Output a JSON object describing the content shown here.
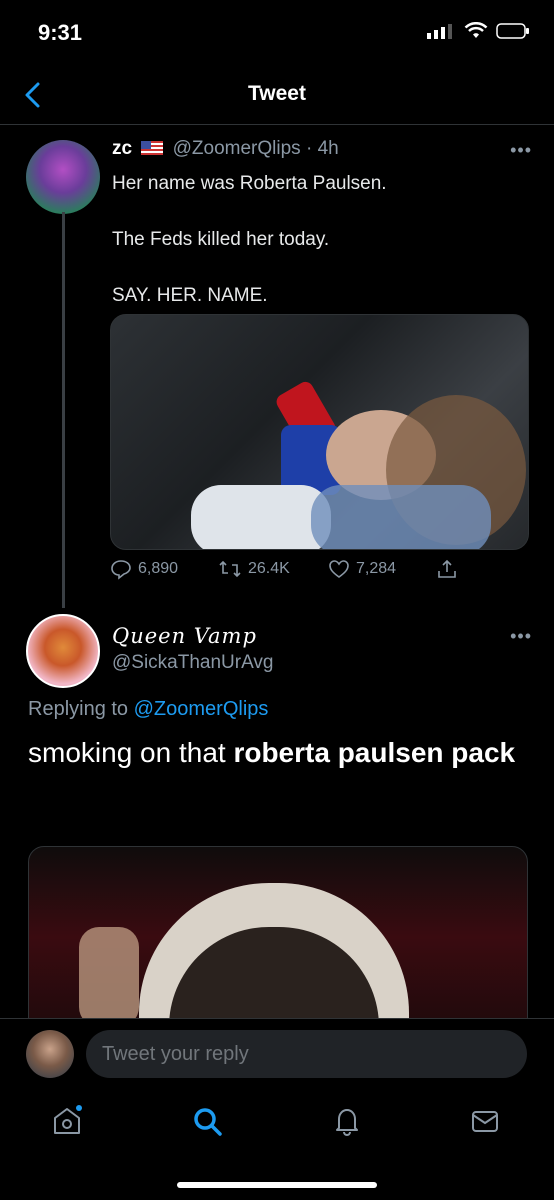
{
  "status_bar": {
    "time": "9:31"
  },
  "header": {
    "title": "Tweet"
  },
  "tweet": {
    "display_name": "zc",
    "handle": "@ZoomerQlips",
    "age": "4h",
    "text_lines": [
      "Her name was Roberta Paulsen.",
      "The Feds killed her today.",
      "SAY. HER. NAME."
    ],
    "stats": {
      "replies": "6,890",
      "retweets": "26.4K",
      "likes": "7,284"
    }
  },
  "reply": {
    "display_name": "Queen Vamp",
    "handle": "@SickaThanUrAvg",
    "replying_prefix": "Replying to",
    "replying_to": "@ZoomerQlips",
    "text_normal": "smoking on that ",
    "text_bold": "roberta paulsen pack"
  },
  "composer": {
    "placeholder": "Tweet your reply"
  },
  "colors": {
    "accent": "#1d9bf0",
    "background": "#000000",
    "secondary_text": "#8b98a5"
  }
}
